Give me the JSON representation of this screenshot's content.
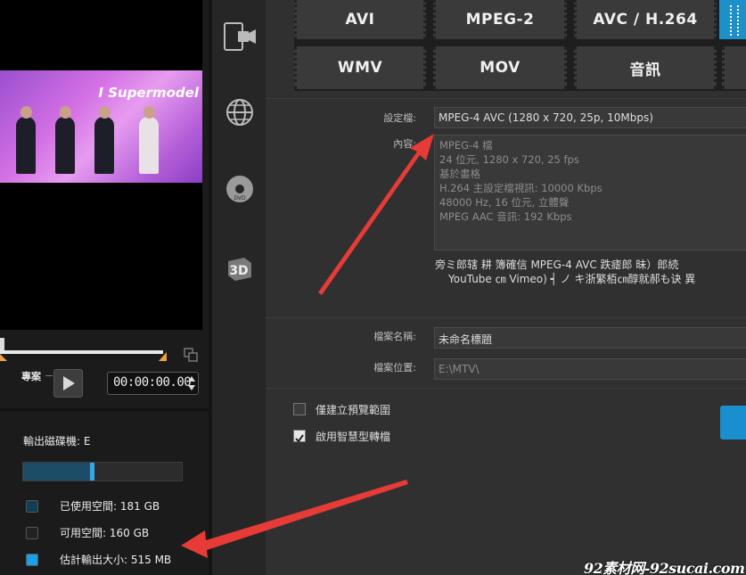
{
  "preview": {
    "video_title": "I Supermodel",
    "control_label": "專案",
    "timecode": "00:00:00.00"
  },
  "disk": {
    "label": "輸出磁碟機: E",
    "used_fraction": 0.45,
    "legend": [
      {
        "label": "已使用空間: 181 GB",
        "color": "#0f3f55"
      },
      {
        "label": "可用空間: 160 GB",
        "color": "#222222"
      },
      {
        "label": "估計輸出大小: 515 MB",
        "color": "#1aa0e6"
      }
    ]
  },
  "sidebar_icons": [
    "device-icon",
    "web-icon",
    "disc-icon",
    "3d-icon"
  ],
  "formats": {
    "row1": [
      "AVI",
      "MPEG-2",
      "AVC / H.264"
    ],
    "row2": [
      "WMV",
      "MOV",
      "音訊"
    ]
  },
  "settings": {
    "profile_label": "設定檔:",
    "profile_value": "MPEG-4 AVC (1280 x 720, 25p, 10Mbps)",
    "content_label": "內容:",
    "content_lines": [
      "MPEG-4 檔",
      "24 位元, 1280 x 720, 25 fps",
      "基於畫格",
      "H.264 主設定檔視訊: 10000 Kbps",
      "48000 Hz, 16 位元, 立體聲",
      "MPEG AAC 音訊: 192 Kbps"
    ],
    "note_line1": "旁ミ郎辖     耕     簿確信 MPEG-4 AVC 跌瘧郎      昧）郎続",
    "note_line2": "YouTube ㎝ Vimeo) ┥ ノ   キ浙繁栢㎝醇就郝も诀   異"
  },
  "file": {
    "name_label": "檔案名稱:",
    "name_value": "未命名標題",
    "location_label": "檔案位置:",
    "location_value": "E:\\MTV\\"
  },
  "options": [
    {
      "label": "僅建立預覽範圍",
      "checked": false
    },
    {
      "label": "啟用智慧型轉檔",
      "checked": true
    }
  ],
  "watermark": "92素材网-92sucai.com"
}
